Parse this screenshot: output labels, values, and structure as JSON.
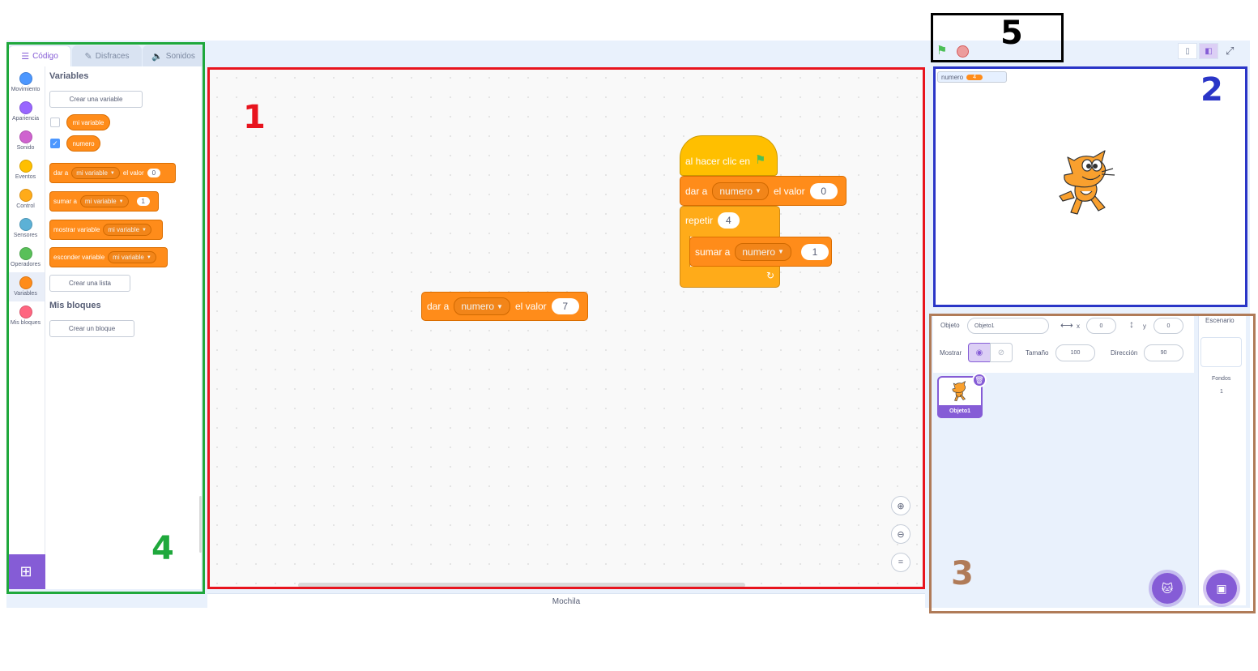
{
  "tabs": [
    {
      "label": "Código",
      "icon": "code-icon"
    },
    {
      "label": "Disfraces",
      "icon": "brush-icon"
    },
    {
      "label": "Sonidos",
      "icon": "speaker-icon"
    }
  ],
  "categories": [
    {
      "label": "Movimiento",
      "color": "#4c97ff"
    },
    {
      "label": "Apariencia",
      "color": "#9966ff"
    },
    {
      "label": "Sonido",
      "color": "#cf63cf"
    },
    {
      "label": "Eventos",
      "color": "#ffbf00"
    },
    {
      "label": "Control",
      "color": "#ffab19"
    },
    {
      "label": "Sensores",
      "color": "#5cb1d6"
    },
    {
      "label": "Operadores",
      "color": "#59c059"
    },
    {
      "label": "Variables",
      "color": "#ff8c1a"
    },
    {
      "label": "Mis bloques",
      "color": "#ff6680"
    }
  ],
  "palette": {
    "variables_title": "Variables",
    "make_variable": "Crear una variable",
    "var1": "mi variable",
    "var2": "numero",
    "set_block": {
      "label": "dar a",
      "dropdown": "mi variable",
      "label2": "el valor",
      "value": "0"
    },
    "change_block": {
      "label": "sumar a",
      "dropdown": "mi variable",
      "value": "1"
    },
    "show_block": {
      "label": "mostrar variable",
      "dropdown": "mi variable"
    },
    "hide_block": {
      "label": "esconder variable",
      "dropdown": "mi variable"
    },
    "make_list": "Crear una lista",
    "my_blocks_title": "Mis bloques",
    "make_block": "Crear un bloque"
  },
  "code": {
    "loose_block": {
      "label": "dar a",
      "dropdown": "numero",
      "label2": "el valor",
      "value": "7"
    },
    "hat": {
      "label": "al hacer clic en"
    },
    "set": {
      "label": "dar a",
      "dropdown": "numero",
      "label2": "el valor",
      "value": "0"
    },
    "repeat": {
      "label": "repetir",
      "value": "4"
    },
    "change": {
      "label": "sumar a",
      "dropdown": "numero",
      "value": "1"
    }
  },
  "backpack": "Mochila",
  "stage": {
    "monitor_label": "numero",
    "monitor_value": "4"
  },
  "sprite_info": {
    "sprite_label": "Objeto",
    "sprite_name": "Objeto1",
    "x_label": "x",
    "x_value": "0",
    "y_label": "y",
    "y_value": "0",
    "show_label": "Mostrar",
    "size_label": "Tamaño",
    "size_value": "100",
    "direction_label": "Dirección",
    "direction_value": "90"
  },
  "sprites": [
    {
      "name": "Objeto1"
    }
  ],
  "stage_pane": {
    "title": "Escenario",
    "backdrops_label": "Fondos",
    "backdrops_count": "1"
  },
  "annotations": {
    "n1": "1",
    "n2": "2",
    "n3": "3",
    "n4": "4",
    "n5": "5",
    "color_red": "#e8141e",
    "color_blue": "#2a35c7",
    "color_brown": "#b07b58",
    "color_green": "#1fa83c",
    "color_black": "#000000"
  }
}
